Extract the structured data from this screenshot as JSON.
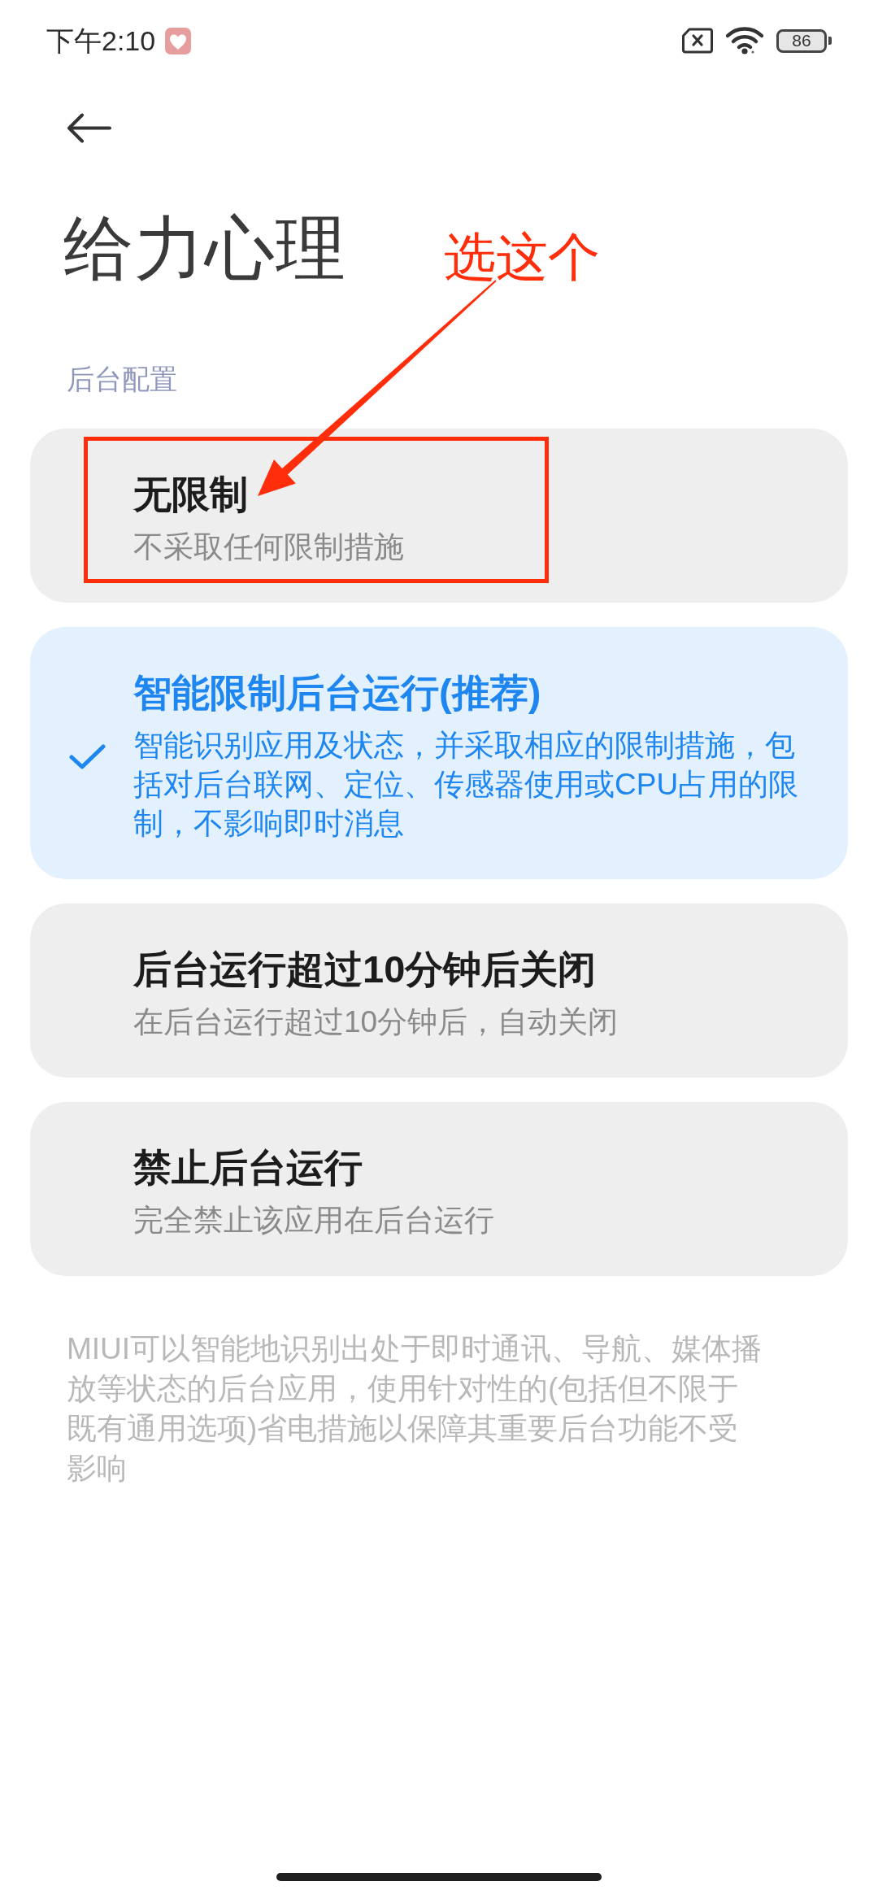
{
  "status_bar": {
    "time": "下午2:10",
    "battery": "86"
  },
  "header": {
    "title": "给力心理"
  },
  "annotation": {
    "text": "选这个"
  },
  "section": {
    "label": "后台配置"
  },
  "options": [
    {
      "title": "无限制",
      "description": "不采取任何限制措施",
      "selected": false,
      "highlighted": true
    },
    {
      "title": "智能限制后台运行(推荐)",
      "description": "智能识别应用及状态，并采取相应的限制措施，包括对后台联网、定位、传感器使用或CPU占用的限制，不影响即时消息",
      "selected": true,
      "highlighted": false
    },
    {
      "title": "后台运行超过10分钟后关闭",
      "description": "在后台运行超过10分钟后，自动关闭",
      "selected": false,
      "highlighted": false
    },
    {
      "title": "禁止后台运行",
      "description": "完全禁止该应用在后台运行",
      "selected": false,
      "highlighted": false
    }
  ],
  "footnote": "MIUI可以智能地识别出处于即时通讯、导航、媒体播放等状态的后台应用，使用针对性的(包括但不限于既有通用选项)省电措施以保障其重要后台功能不受影响"
}
